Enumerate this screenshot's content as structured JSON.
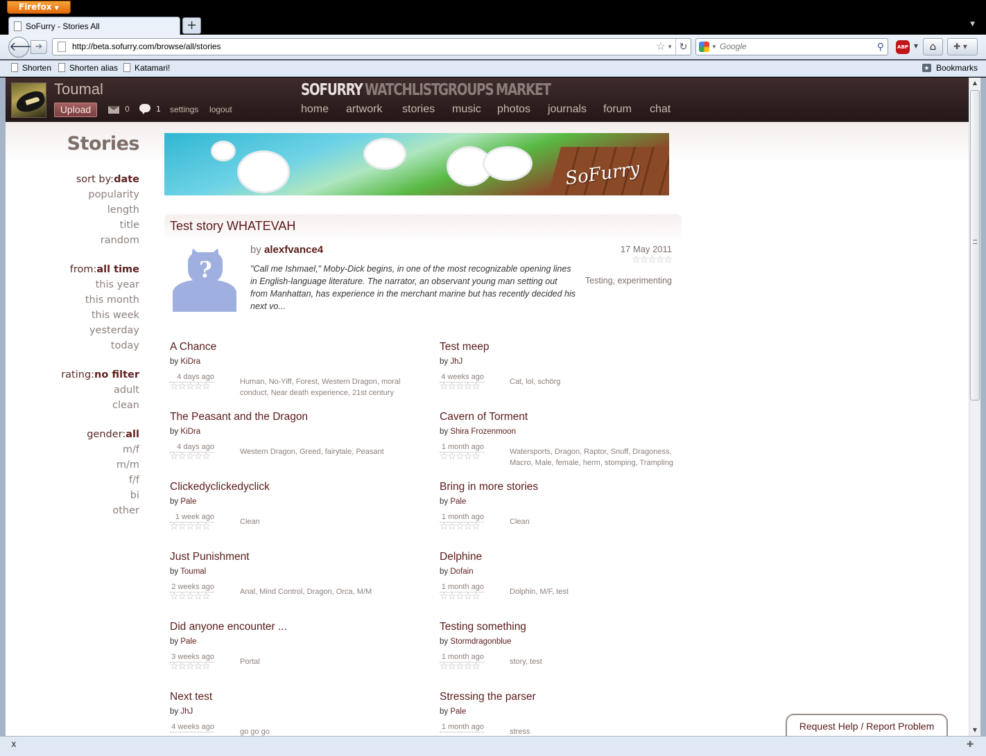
{
  "browser": {
    "menu_button": "Firefox",
    "tab_title": "SoFurry - Stories All",
    "new_tab": "+",
    "url": "http://beta.sofurry.com/browse/all/stories",
    "search_placeholder": "Google",
    "bookmarks": [
      "Shorten",
      "Shorten alias",
      "Katamari!"
    ],
    "bookmarks_menu": "Bookmarks",
    "status_close": "x"
  },
  "site": {
    "username": "Toumal",
    "upload_label": "Upload",
    "mail_count": "0",
    "chat_count": "1",
    "settings_label": "settings",
    "logout_label": "logout",
    "sections": [
      "SOFURRY",
      "WATCHLIST",
      "GROUPS",
      "MARKET"
    ],
    "active_section": "SOFURRY",
    "subnav": [
      "home",
      "artwork",
      "stories",
      "music",
      "photos",
      "journals",
      "forum",
      "chat"
    ]
  },
  "sidebar": {
    "heading": "Stories",
    "sort": {
      "label": "sort by:",
      "selected": "date",
      "options": [
        "popularity",
        "length",
        "title",
        "random"
      ]
    },
    "from": {
      "label": "from:",
      "selected": "all time",
      "options": [
        "this year",
        "this month",
        "this week",
        "yesterday",
        "today"
      ]
    },
    "rating": {
      "label": "rating:",
      "selected": "no filter",
      "options": [
        "adult",
        "clean"
      ]
    },
    "gender": {
      "label": "gender:",
      "selected": "all",
      "options": [
        "m/f",
        "m/m",
        "f/f",
        "bi",
        "other"
      ]
    }
  },
  "banner": {
    "logo": "SoFurry"
  },
  "featured": {
    "title": "Test story WHATEVAH",
    "by_label": "by",
    "author": "alexfvance4",
    "date": "17 May 2011",
    "stars": "☆☆☆☆☆",
    "tags": "Testing, experimenting",
    "blurb": "\"Call me Ishmael,\" Moby-Dick begins, in one of the most recognizable opening lines in English-language literature. The narrator, an observant young man setting out from Manhattan, has experience in the merchant marine but has recently decided his next vo..."
  },
  "stories": [
    {
      "title": "A Chance",
      "author": "KiDra",
      "date": "4 days ago",
      "stars": "☆☆☆☆☆",
      "tags": "Human, No-Yiff, Forest, Western Dragon, moral conduct, Near death experience, 21st century"
    },
    {
      "title": "Test meep",
      "author": "JhJ",
      "date": "4 weeks ago",
      "stars": "☆☆☆☆☆",
      "tags": "Cat, lol, schörg"
    },
    {
      "title": "The Peasant and the Dragon",
      "author": "KiDra",
      "date": "4 days ago",
      "stars": "☆☆☆☆☆",
      "tags": "Western Dragon, Greed, fairytale, Peasant"
    },
    {
      "title": "Cavern of Torment",
      "author": "Shira Frozenmoon",
      "date": "1 month ago",
      "stars": "☆☆☆☆☆",
      "tags": "Watersports, Dragon, Raptor, Snuff, Dragoness, Macro, Male, female, herm, stomping, Trampling"
    },
    {
      "title": "Clickedyclickedyclick",
      "author": "Pale",
      "date": "1 week ago",
      "stars": "☆☆☆☆☆",
      "tags": "Clean"
    },
    {
      "title": "Bring in more stories",
      "author": "Pale",
      "date": "1 month ago",
      "stars": "☆☆☆☆☆",
      "tags": "Clean"
    },
    {
      "title": "Just Punishment",
      "author": "Toumal",
      "date": "2 weeks ago",
      "stars": "☆☆☆☆☆",
      "tags": "Anal, Mind Control, Dragon, Orca, M/M"
    },
    {
      "title": "Delphine",
      "author": "Dofain",
      "date": "1 month ago",
      "stars": "☆☆☆☆☆",
      "tags": "Dolphin, M/F, test"
    },
    {
      "title": "Did anyone encounter ...",
      "author": "Pale",
      "date": "3 weeks ago",
      "stars": "☆☆☆☆☆",
      "tags": "Portal"
    },
    {
      "title": "Testing something",
      "author": "Stormdragonblue",
      "date": "1 month ago",
      "stars": "☆☆☆☆☆",
      "tags": "story, test"
    },
    {
      "title": "Next test",
      "author": "JhJ",
      "date": "4 weeks ago",
      "stars": "",
      "tags": "go go go"
    },
    {
      "title": "Stressing the parser",
      "author": "Pale",
      "date": "1 month ago",
      "stars": "",
      "tags": "stress"
    }
  ],
  "story_by_label": "by",
  "help": {
    "request": "Request Help",
    "separator": "/",
    "report": "Report Problem"
  }
}
